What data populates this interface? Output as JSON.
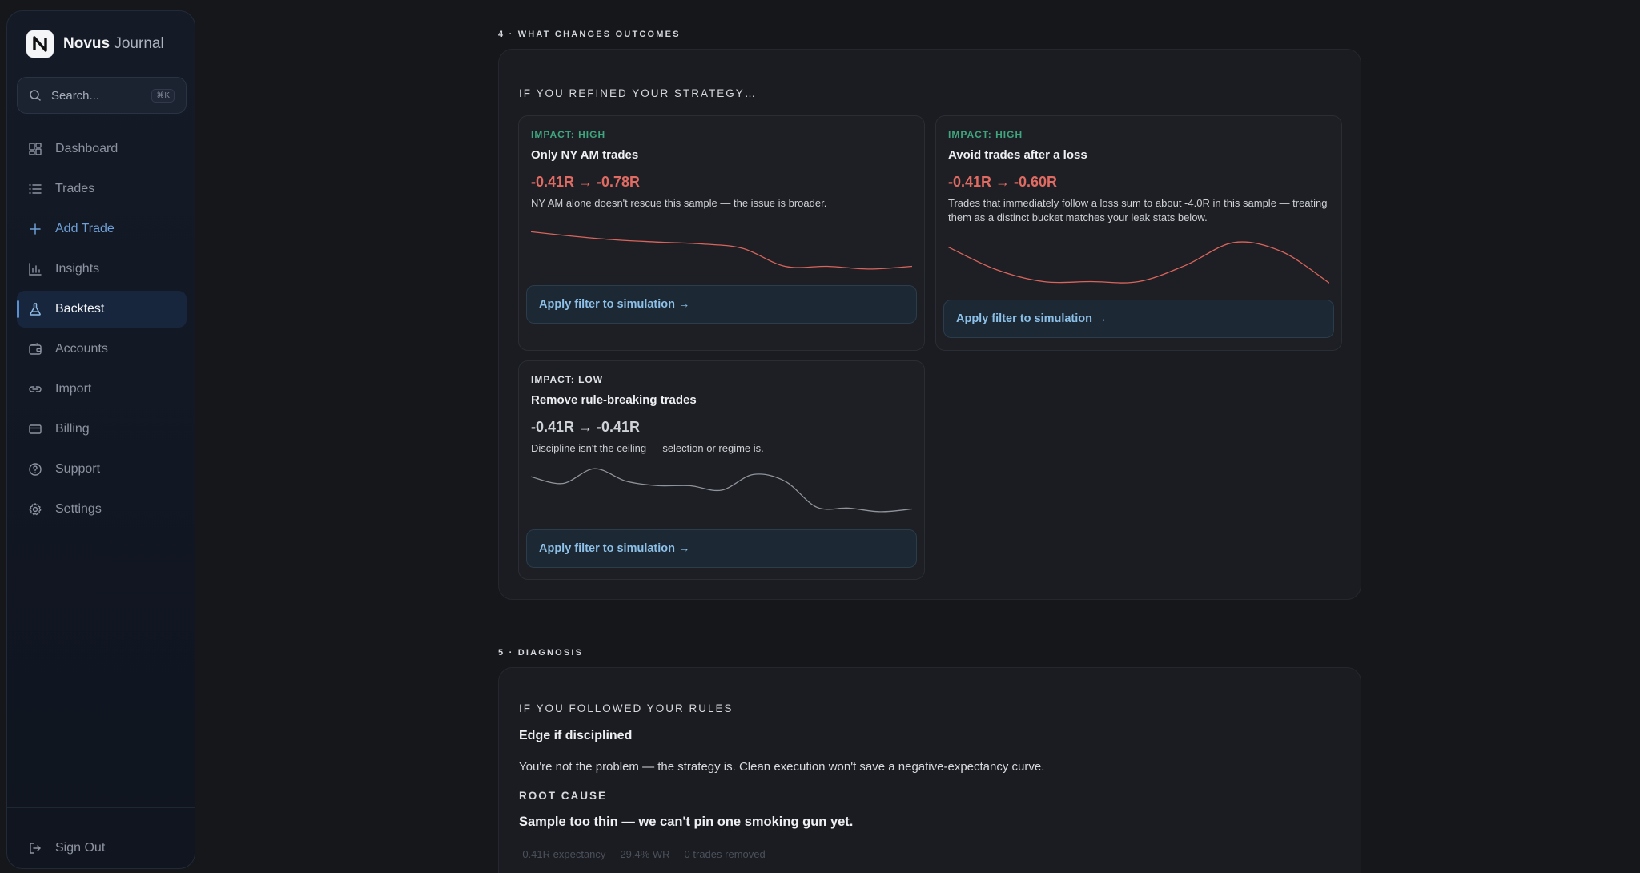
{
  "app": {
    "name_bold": "Novus",
    "name_light": " Journal",
    "logo_letter": "N"
  },
  "search": {
    "placeholder": "Search...",
    "shortcut": "⌘K"
  },
  "nav": [
    {
      "label": "Dashboard",
      "icon": "dashboard-icon"
    },
    {
      "label": "Trades",
      "icon": "list-icon"
    },
    {
      "label": "Add Trade",
      "icon": "plus-icon"
    },
    {
      "label": "Insights",
      "icon": "bar-chart-icon"
    },
    {
      "label": "Backtest",
      "icon": "flask-icon"
    },
    {
      "label": "Accounts",
      "icon": "wallet-icon"
    },
    {
      "label": "Import",
      "icon": "link-icon"
    },
    {
      "label": "Billing",
      "icon": "credit-card-icon"
    },
    {
      "label": "Support",
      "icon": "help-circle-icon"
    },
    {
      "label": "Settings",
      "icon": "gear-icon"
    }
  ],
  "active_nav": "Backtest",
  "sign_out": "Sign Out",
  "outcomes": {
    "section_label": "4 · WHAT CHANGES OUTCOMES",
    "title": "IF YOU REFINED YOUR STRATEGY…",
    "cards": [
      {
        "impact": "IMPACT: HIGH",
        "title": "Only NY AM trades",
        "metric": "-0.41R → -0.78R",
        "desc": "NY AM alone doesn't rescue this sample — the issue is broader.",
        "button": "Apply filter to simulation →",
        "line_color": "#d9645c",
        "spark": [
          0.15,
          0.25,
          0.33,
          0.38,
          0.42,
          0.52,
          0.92,
          0.92,
          0.98,
          0.92
        ]
      },
      {
        "impact": "IMPACT: HIGH",
        "title": "Avoid trades after a loss",
        "metric": "-0.41R → -0.60R",
        "desc": "Trades that immediately follow a loss sum to about -4.0R in this sample — treating them as a distinct bucket matches your leak stats below.",
        "button": "Apply filter to simulation →",
        "line_color": "#d9645c",
        "spark": [
          0.15,
          0.65,
          0.92,
          0.92,
          0.92,
          0.55,
          0.05,
          0.25,
          0.95
        ]
      },
      {
        "impact": "IMPACT: LOW",
        "title": "Remove rule-breaking trades",
        "metric": "-0.41R → -0.41R",
        "desc": "Discipline isn't the ceiling — selection or regime is.",
        "button": "Apply filter to simulation →",
        "line_color": "#8f939b",
        "spark": [
          0.2,
          0.35,
          0.02,
          0.3,
          0.4,
          0.4,
          0.5,
          0.15,
          0.3,
          0.88,
          0.9,
          0.98,
          0.92
        ]
      }
    ]
  },
  "diagnosis": {
    "section_label": "5 · DIAGNOSIS",
    "title": "IF YOU FOLLOWED YOUR RULES",
    "heading": "Edge if disciplined",
    "text": "You're not the problem — the strategy is. Clean execution won't save a negative-expectancy curve.",
    "root_label": "ROOT CAUSE",
    "root_text": "Sample too thin — we can't pin one smoking gun yet.",
    "stats": [
      "-0.41R expectancy",
      "29.4% WR",
      "0 trades removed"
    ]
  }
}
